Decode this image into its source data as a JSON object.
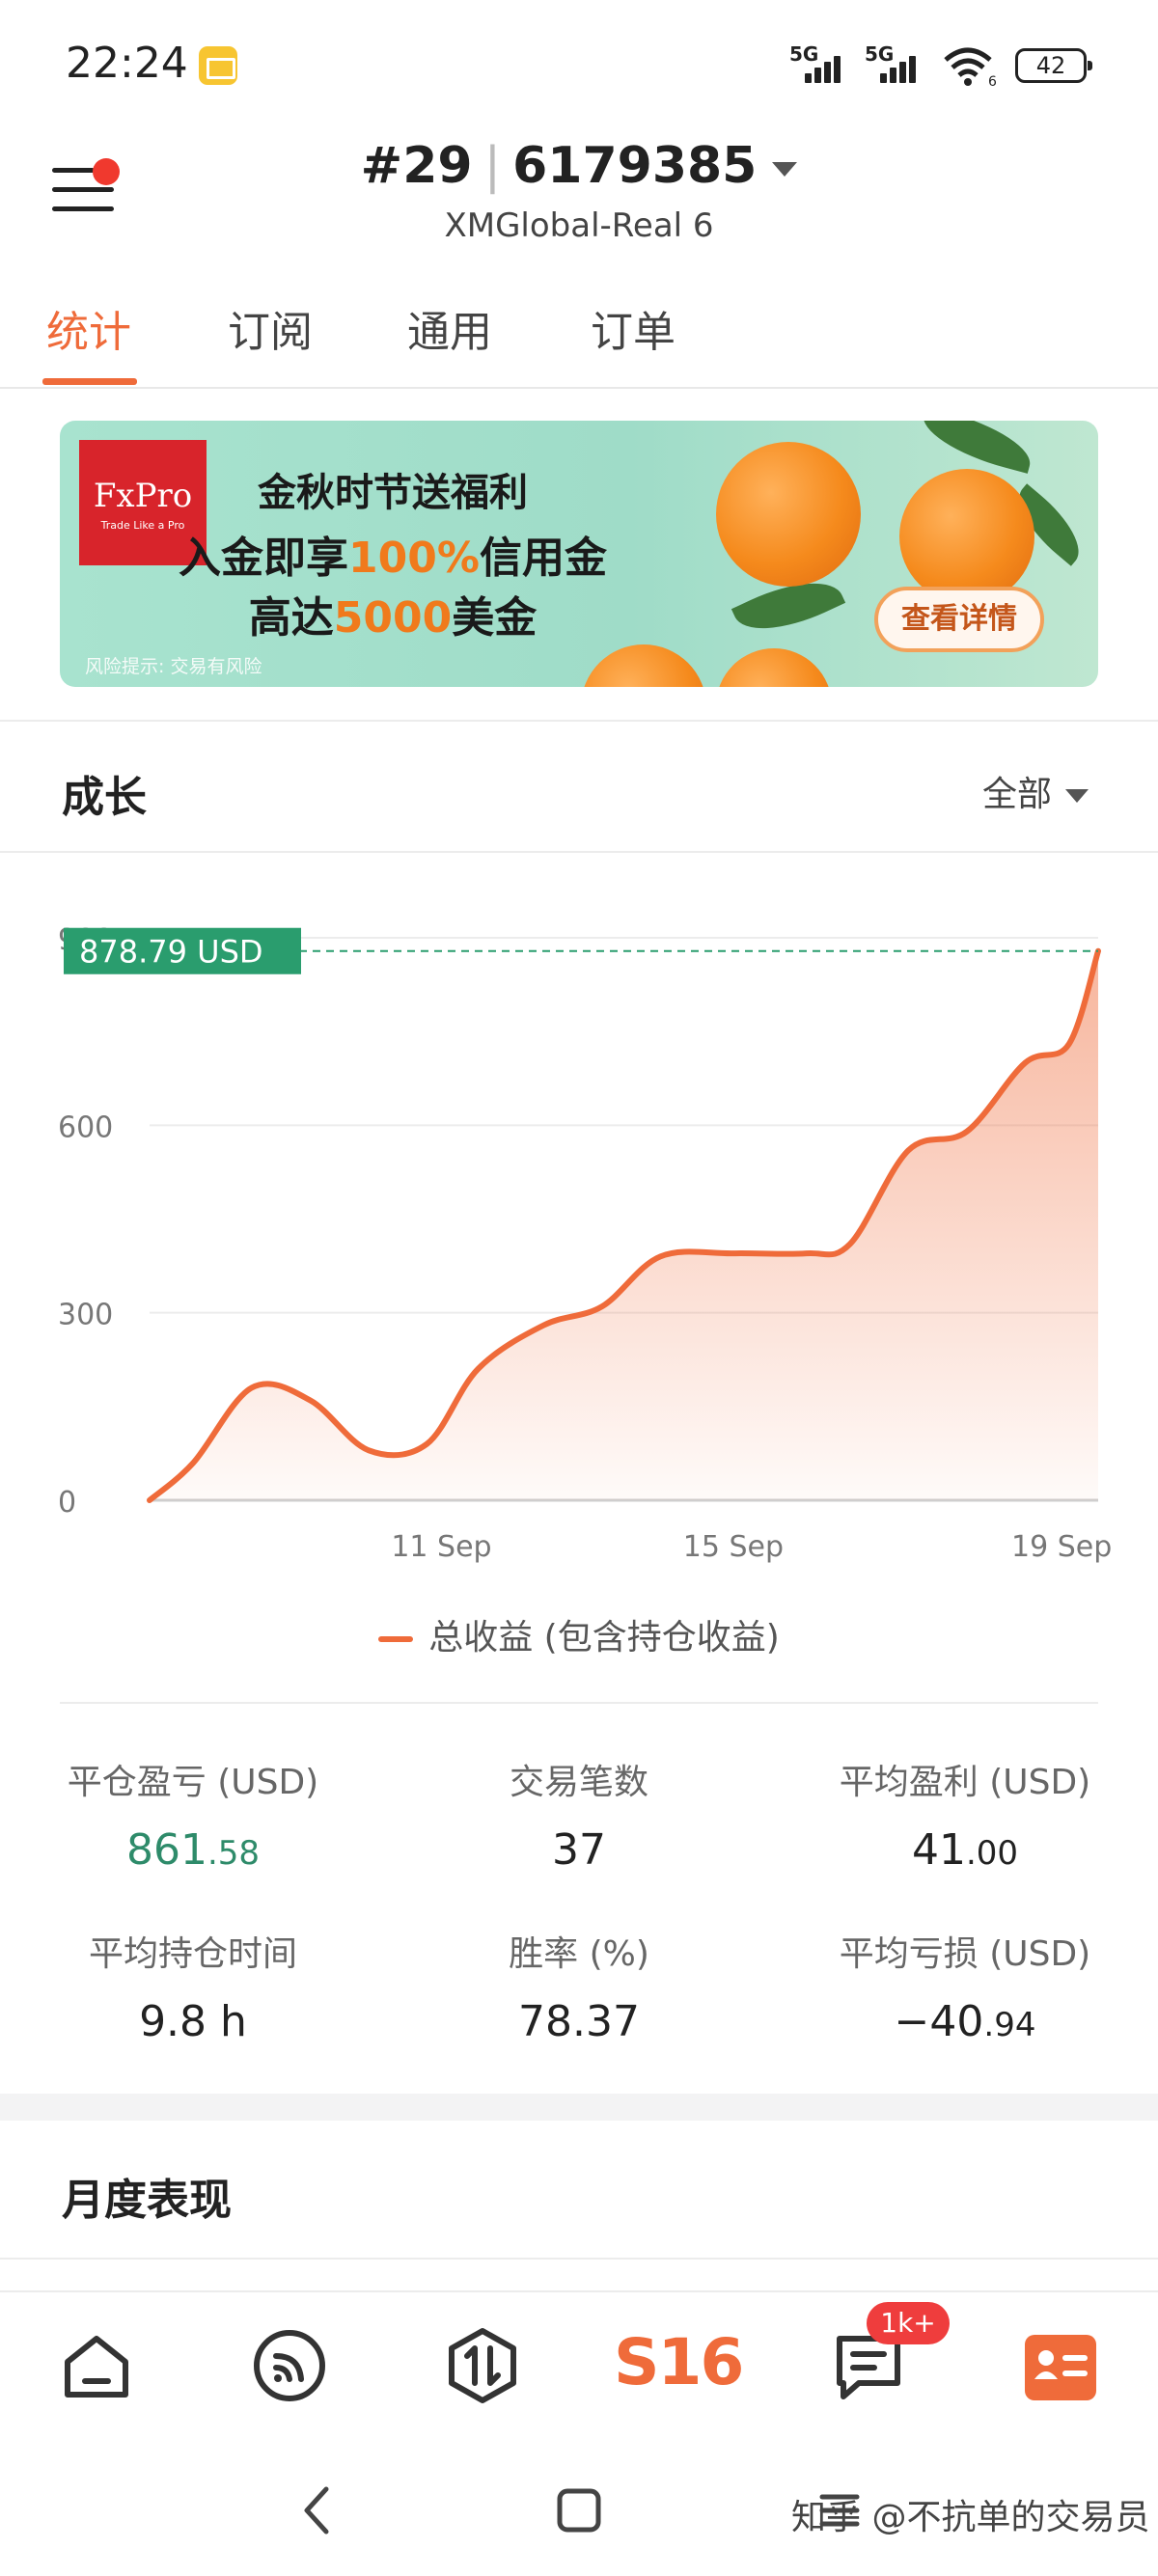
{
  "status_bar": {
    "time": "22:24",
    "signal1": "5G",
    "signal2": "5G",
    "wifi_sub": "6",
    "battery": "42"
  },
  "header": {
    "account_rank": "#29",
    "account_id": "6179385",
    "server": "XMGlobal-Real 6"
  },
  "tabs": [
    {
      "label": "统计",
      "active": true
    },
    {
      "label": "订阅",
      "active": false
    },
    {
      "label": "通用",
      "active": false
    },
    {
      "label": "订单",
      "active": false
    }
  ],
  "banner": {
    "logo_text": "FxPro",
    "logo_tagline": "Trade Like a Pro",
    "line1": "金秋时节送福利",
    "line2_prefix": "入金即享",
    "line2_highlight": "100%",
    "line2_suffix": "信用金",
    "line3_prefix": "高达",
    "line3_highlight": "5000",
    "line3_suffix": "美金",
    "risk_note": "风险提示: 交易有风险",
    "button_label": "查看详情"
  },
  "growth": {
    "title": "成长",
    "filter": "全部"
  },
  "chart_data": {
    "type": "area",
    "current_value_label": "878.79 USD",
    "current_value": 878.79,
    "y_ticks": [
      "0",
      "300",
      "600",
      "900"
    ],
    "ylim": [
      0,
      900
    ],
    "x_tick_labels": [
      "11 Sep",
      "15 Sep",
      "19 Sep"
    ],
    "x_tick_positions": [
      5,
      9,
      13.5
    ],
    "series": [
      {
        "name": "总收益 (包含持仓收益)",
        "x": [
          1,
          1.6,
          2.4,
          3.2,
          4,
          4.8,
          5.5,
          6.4,
          7.2,
          8,
          9,
          10,
          10.6,
          11.4,
          12.2,
          13,
          13.6,
          14
        ],
        "y": [
          0,
          60,
          180,
          160,
          80,
          90,
          210,
          280,
          310,
          390,
          395,
          395,
          410,
          560,
          590,
          700,
          730,
          878.79
        ],
        "color": "#ef6b3a"
      }
    ],
    "xlabel": "",
    "ylabel": "",
    "grid": true,
    "legend_position": "bottom"
  },
  "stats": [
    {
      "label": "平仓盈亏 (USD)",
      "int": "861",
      "dec": ".58",
      "color": "green"
    },
    {
      "label": "交易笔数",
      "int": "37",
      "dec": "",
      "color": "default"
    },
    {
      "label": "平均盈利 (USD)",
      "int": "41",
      "dec": ".00",
      "color": "default"
    },
    {
      "label": "平均持仓时间",
      "int": "9.8 h",
      "dec": "",
      "color": "default"
    },
    {
      "label": "胜率 (%)",
      "int": "78.37",
      "dec": "",
      "color": "default"
    },
    {
      "label": "平均亏损 (USD)",
      "int": "−40",
      "dec": ".94",
      "color": "default"
    }
  ],
  "monthly": {
    "title": "月度表现"
  },
  "bottom_nav": {
    "items": [
      "home-icon",
      "feed-icon",
      "trade-icon",
      "s16-icon",
      "messages-icon",
      "profile-icon"
    ],
    "s16_label": "S16",
    "badge": "1k+"
  },
  "watermark": "知乎 @不抗单的交易员",
  "colors": {
    "accent": "#ef6b3a",
    "profit_green": "#2e8b6a",
    "value_tag": "#2a9d6e",
    "badge_red": "#ef3d3d"
  }
}
